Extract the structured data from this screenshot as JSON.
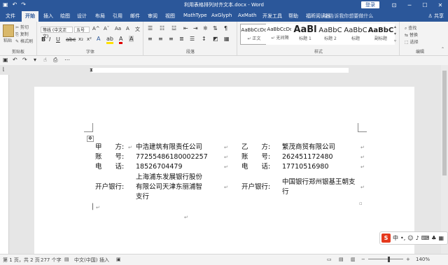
{
  "window": {
    "title": "利用表格排列对齐文本.docx - Word",
    "login": "登录"
  },
  "tabs": [
    "文件",
    "开始",
    "插入",
    "绘图",
    "设计",
    "布局",
    "引用",
    "邮件",
    "审阅",
    "视图",
    "MathType",
    "AxGlyph",
    "AxMath",
    "开发工具",
    "帮助",
    "福昕阅读器"
  ],
  "active_tab": "开始",
  "tellme": "告诉我你想要做什么",
  "share": "共享",
  "clipboard": {
    "paste": "粘贴",
    "cut": "剪切",
    "copy": "复制",
    "painter": "格式刷",
    "label": "剪贴板"
  },
  "font": {
    "name": "等线 (中文正文)",
    "size": "五号",
    "label": "字体"
  },
  "paragraph": {
    "label": "段落"
  },
  "styles": {
    "label": "样式",
    "items": [
      {
        "sample": "AaBbCcDd",
        "name": "↵ 正文"
      },
      {
        "sample": "AaBbCcDd",
        "name": "↵ 无间隔"
      },
      {
        "sample": "AaBl",
        "name": "标题 1"
      },
      {
        "sample": "AaBbC",
        "name": "标题 2"
      },
      {
        "sample": "AaBbC",
        "name": "标题"
      },
      {
        "sample": "AaBbC",
        "name": "副标题"
      }
    ]
  },
  "editing": {
    "find": "查找",
    "replace": "替换",
    "select": "选择",
    "label": "编辑"
  },
  "document": {
    "left": {
      "label1": "甲　　方:",
      "value1": "中浩建筑有限责任公司",
      "label2": "账　　号:",
      "value2": "77255486180002257",
      "label3": "电　　话:",
      "value3": "18526704479",
      "label4": "开户银行:",
      "value4_l1": "上海浦东发展银行股份",
      "value4_l2": "有限公司天津东丽浦智",
      "value4_l3": "支行"
    },
    "right": {
      "label1": "乙　　方:",
      "value1": "繁茂商贸有限公司",
      "label2": "账　　号:",
      "value2": "262451172480",
      "label3": "电　　话:",
      "value3": "17710516980",
      "label4": "开户银行:",
      "value4_l1": "中国银行郑州银基王朝支",
      "value4_l2": "行"
    }
  },
  "ime": {
    "lang": "中"
  },
  "status": {
    "page": "第 1 页，共 2 页",
    "words": "277 个字",
    "lang": "中文(中国)",
    "mode": "插入",
    "zoom": "140%"
  }
}
